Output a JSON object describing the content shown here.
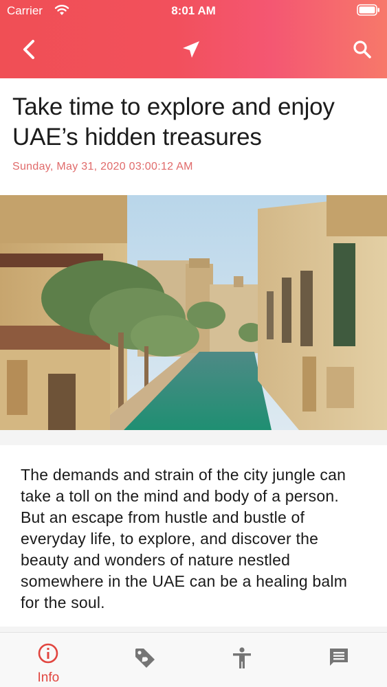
{
  "status_bar": {
    "carrier": "Carrier",
    "time": "8:01 AM"
  },
  "nav": {
    "back_icon": "chevron-left-icon",
    "center_icon": "paper-plane-icon",
    "search_icon": "search-icon",
    "gradient_colors": [
      "#f04f55",
      "#f7786a"
    ]
  },
  "article": {
    "title": "Take time to explore and enjoy UAE’s hidden treasures",
    "date": "Sunday, May 31, 2020 03:00:12 AM",
    "image_alt": "Canal lined with palm trees and sand-coloured buildings",
    "body": "The demands and strain of the city jungle can take a toll on the mind and body of a person.  But an escape from hustle and bustle of everyday life, to explore, and discover the beauty and wonders of nature nestled somewhere in the UAE can be a healing balm for the soul."
  },
  "tabbar": {
    "tabs": [
      {
        "label": "Info",
        "icon": "info-icon",
        "active": true
      },
      {
        "label": "",
        "icon": "tag-icon",
        "active": false
      },
      {
        "label": "",
        "icon": "accessibility-icon",
        "active": false
      },
      {
        "label": "",
        "icon": "chat-icon",
        "active": false
      }
    ],
    "active_color": "#e1453f",
    "inactive_color": "#757575"
  }
}
